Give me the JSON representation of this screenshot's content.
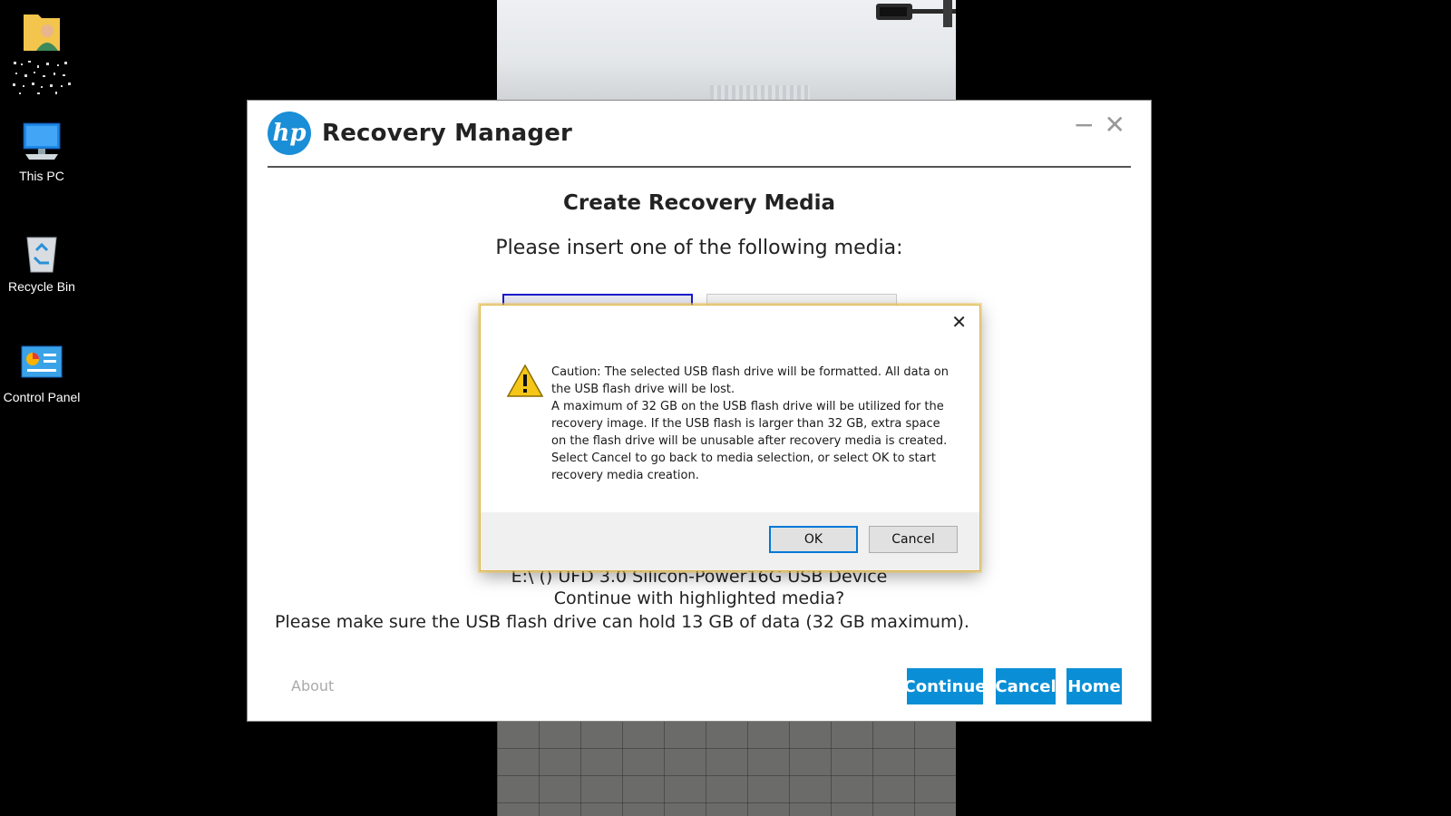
{
  "desktop": {
    "icons": [
      {
        "label": "",
        "icon": "user-folder-icon"
      },
      {
        "label": "This PC",
        "icon": "computer-icon"
      },
      {
        "label": "Recycle Bin",
        "icon": "recycle-bin-icon"
      },
      {
        "label": "Control Panel",
        "icon": "control-panel-icon"
      }
    ]
  },
  "app": {
    "logo_text": "hp",
    "title": "Recovery Manager",
    "minimize_glyph": "−",
    "close_glyph": "✕",
    "heading": "Create Recovery Media",
    "subheading": "Please insert one of the following media:",
    "device_line": "E:\\ () UFD 3.0 Silicon-Power16G USB Device",
    "continue_question": "Continue with highlighted media?",
    "capacity_note": "Please make sure the USB flash drive can hold 13 GB of data (32 GB maximum).",
    "about_label": "About",
    "buttons": {
      "continue": "Continue",
      "cancel": "Cancel",
      "home": "Home"
    },
    "accent_color": "#0a8fd6"
  },
  "dialog": {
    "close_glyph": "✕",
    "icon": "warning-icon",
    "lines": [
      "Caution: The selected USB flash drive will be formatted. All data on the USB flash drive will be lost.",
      "A maximum of 32 GB on the USB flash drive will be utilized for the recovery image. If the USB flash is larger than 32 GB, extra space on the flash drive will be unusable after recovery media is created.",
      "Select Cancel to go back to media selection, or select OK to start recovery media creation."
    ],
    "ok_label": "OK",
    "cancel_label": "Cancel"
  }
}
